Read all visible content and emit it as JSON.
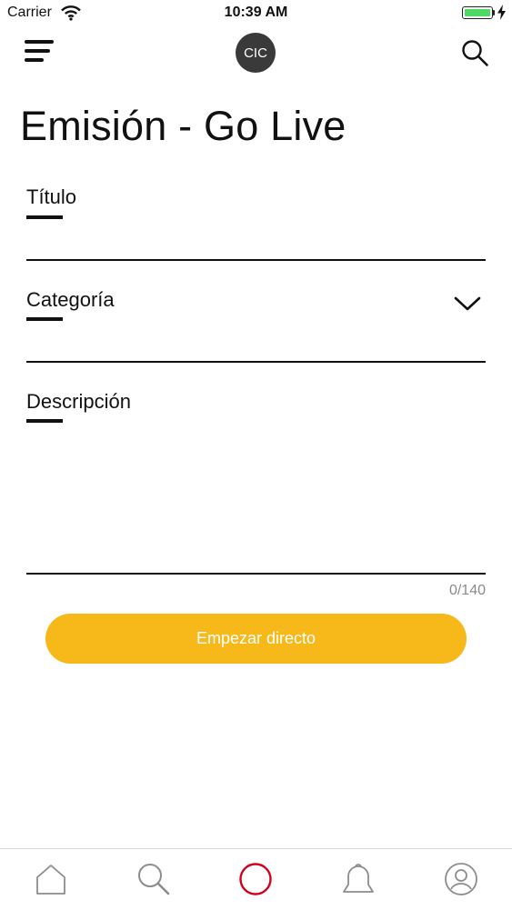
{
  "status": {
    "carrier": "Carrier",
    "time": "10:39 AM",
    "battery_color": "#4cd964"
  },
  "nav": {
    "menu_icon": "hamburger-menu-icon",
    "logo_text": "CIC",
    "search_icon": "search-icon"
  },
  "page": {
    "title": "Emisión - Go Live"
  },
  "form": {
    "title_label": "Título",
    "title_value": "",
    "category_label": "Categoría",
    "category_value": "",
    "category_icon": "chevron-down-icon",
    "description_label": "Descripción",
    "description_value": "",
    "counter": "0/140"
  },
  "cta": {
    "label": "Empezar directo",
    "color": "#f7b819"
  },
  "tabbar": {
    "items": [
      {
        "icon": "home-icon"
      },
      {
        "icon": "search-icon"
      },
      {
        "icon": "live-record-icon",
        "color": "#d0021b"
      },
      {
        "icon": "bell-icon"
      },
      {
        "icon": "profile-icon"
      }
    ]
  }
}
